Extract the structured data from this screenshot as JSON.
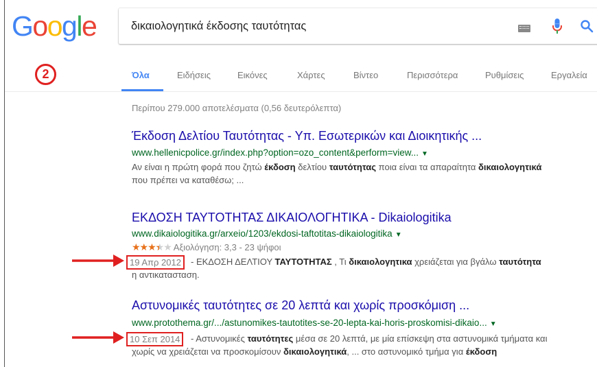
{
  "logo": {
    "letters": [
      "G",
      "o",
      "o",
      "g",
      "l",
      "e"
    ],
    "colors": [
      "#4285f4",
      "#ea4335",
      "#fbbc05",
      "#4285f4",
      "#34a853",
      "#ea4335"
    ]
  },
  "search": {
    "query": "δικαιολογητικά έκδοσης ταυτότητας"
  },
  "step_badge": "2",
  "tabs": [
    {
      "label": "Όλα",
      "active": true
    },
    {
      "label": "Ειδήσεις"
    },
    {
      "label": "Εικόνες"
    },
    {
      "label": "Χάρτες"
    },
    {
      "label": "Βίντεο"
    },
    {
      "label": "Περισσότερα"
    },
    {
      "label": "Ρυθμίσεις"
    },
    {
      "label": "Εργαλεία"
    }
  ],
  "stats": "Περίπου 279.000 αποτελέσματα (0,56 δευτερόλεπτα)",
  "results": [
    {
      "title": "Έκδοση Δελτίου Ταυτότητας - Υπ. Εσωτερικών και Διοικητικής ...",
      "url": "www.hellenicpolice.gr/index.php?option=ozo_content&perform=view...",
      "snippet_line1": [
        {
          "t": "Αν είναι η πρώτη φορά που ζητώ "
        },
        {
          "t": "έκδοση",
          "b": true
        },
        {
          "t": " δελτίου "
        },
        {
          "t": "ταυτότητας",
          "b": true
        },
        {
          "t": " ποια είναι τα απαραίτητα "
        },
        {
          "t": "δικαιολογητικά",
          "b": true
        }
      ],
      "snippet_line2": "που πρέπει να καταθέσω; ..."
    },
    {
      "title": "ΕΚΔΟΣΗ ΤΑΥΤΟΤΗΤΑΣ ΔΙΚΑΙΟΛΟΓΗΤΙΚΑ - Dikaiologitika",
      "url": "www.dikaiologitika.gr/arxeio/1203/ekdosi-taftotitas-dikaiologitika",
      "rating_stars": 3.3,
      "rating_text": "Αξιολόγηση: 3,3 - 23 ψήφοι",
      "date": "19 Απρ 2012",
      "snippet_line1": [
        {
          "t": " - ΕΚΔΟΣΗ ΔΕΛΤΙΟΥ "
        },
        {
          "t": "ΤΑΥΤΟΤΗΤΑΣ",
          "b": true
        },
        {
          "t": " , Τι "
        },
        {
          "t": "δικαιολογητικα",
          "b": true
        },
        {
          "t": " χρειάζεται για βγάλω "
        },
        {
          "t": "ταυτότητα",
          "b": true
        }
      ],
      "snippet_line2": "η αντικατασταση."
    },
    {
      "title": "Αστυνομικές ταυτότητες σε 20 λεπτά και χωρίς προσκόμιση ...",
      "url": "www.protothema.gr/.../astunomikes-tautotites-se-20-lepta-kai-horis-proskomisi-dikaio...",
      "date": "10 Σεπ 2014",
      "snippet_line1": [
        {
          "t": " - Αστυνομικές "
        },
        {
          "t": "ταυτότητες",
          "b": true
        },
        {
          "t": " μέσα σε 20 λεπτά, με μία επίσκεψη στα αστυνομικά τμήματα και"
        }
      ],
      "snippet_line2_parts": [
        {
          "t": "χωρίς να χρειάζεται να προσκομίσουν "
        },
        {
          "t": "δικαιολογητικά",
          "b": true
        },
        {
          "t": ", ... στο αστυνομικό τμήμα για "
        },
        {
          "t": "έκδοση",
          "b": true
        }
      ]
    }
  ],
  "annotation_color": "#e02020"
}
